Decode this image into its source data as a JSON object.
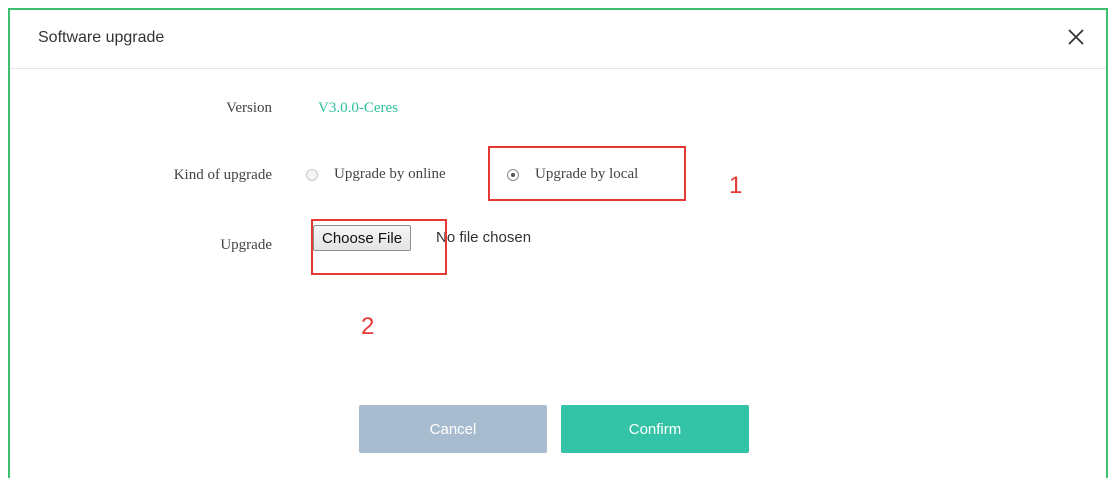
{
  "dialog": {
    "title": "Software upgrade"
  },
  "form": {
    "version_label": "Version",
    "version_value": "V3.0.0-Ceres",
    "kind_label": "Kind of upgrade",
    "options": [
      {
        "label": "Upgrade by online",
        "checked": false
      },
      {
        "label": "Upgrade by local",
        "checked": true
      }
    ],
    "upgrade_label": "Upgrade",
    "file_button_label": "Choose File",
    "file_status": "No file chosen"
  },
  "annotations": {
    "marker_1": "1",
    "marker_2": "2",
    "color": "#e53935"
  },
  "buttons": {
    "cancel_label": "Cancel",
    "confirm_label": "Confirm"
  },
  "colors": {
    "accent": "#35c3a7",
    "version_text": "#2fbf9e",
    "cancel_bg": "#a8bccf",
    "border": "#3cbf6e"
  },
  "icons": {
    "close": "close-icon"
  }
}
